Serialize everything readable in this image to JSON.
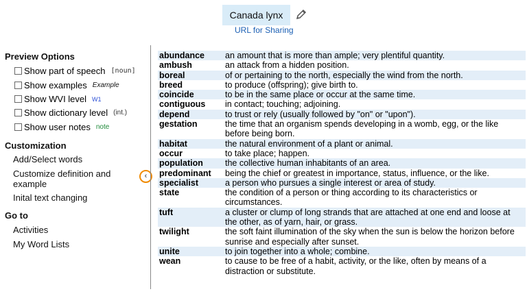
{
  "header": {
    "title": "Canada lynx",
    "share_link": "URL for Sharing"
  },
  "sidebar": {
    "preview_heading": "Preview Options",
    "options": [
      {
        "label": "Show part of speech",
        "extra": "[noun]",
        "checked": false
      },
      {
        "label": "Show examples",
        "extra": "Example",
        "checked": false
      },
      {
        "label": "Show WVI level",
        "extra": "W1",
        "checked": false
      },
      {
        "label": "Show dictionary level",
        "extra": "(int.)",
        "checked": false
      },
      {
        "label": "Show user notes",
        "extra": "note",
        "checked": false
      }
    ],
    "customization_heading": "Customization",
    "customization_links": [
      "Add/Select words",
      "Customize definition and example",
      "Inital text changing"
    ],
    "goto_heading": "Go to",
    "goto_links": [
      "Activities",
      "My Word Lists"
    ],
    "collapse_glyph": "‹"
  },
  "words": [
    {
      "word": "abundance",
      "definition": "an amount that is more than ample; very plentiful quantity."
    },
    {
      "word": "ambush",
      "definition": "an attack from a hidden position."
    },
    {
      "word": "boreal",
      "definition": "of or pertaining to the north, especially the wind from the north."
    },
    {
      "word": "breed",
      "definition": "to produce (offspring); give birth to."
    },
    {
      "word": "coincide",
      "definition": "to be in the same place or occur at the same time."
    },
    {
      "word": "contiguous",
      "definition": "in contact; touching; adjoining."
    },
    {
      "word": "depend",
      "definition": "to trust or rely (usually followed by \"on\" or \"upon\")."
    },
    {
      "word": "gestation",
      "definition": "the time that an organism spends developing in a womb, egg, or the like before being born."
    },
    {
      "word": "habitat",
      "definition": "the natural environment of a plant or animal."
    },
    {
      "word": "occur",
      "definition": "to take place; happen."
    },
    {
      "word": "population",
      "definition": "the collective human inhabitants of an area."
    },
    {
      "word": "predominant",
      "definition": "being the chief or greatest in importance, status, influence, or the like."
    },
    {
      "word": "specialist",
      "definition": "a person who pursues a single interest or area of study."
    },
    {
      "word": "state",
      "definition": "the condition of a person or thing according to its characteristics or circumstances."
    },
    {
      "word": "tuft",
      "definition": "a cluster or clump of long strands that are attached at one end and loose at the other, as of yarn, hair, or grass."
    },
    {
      "word": "twilight",
      "definition": "the soft faint illumination of the sky when the sun is below the horizon before sunrise and especially after sunset."
    },
    {
      "word": "unite",
      "definition": "to join together into a whole; combine."
    },
    {
      "word": "wean",
      "definition": "to cause to be free of a habit, activity, or the like, often by means of a distraction or substitute."
    }
  ],
  "colors": {
    "title_bg": "#d9ecf8",
    "row_shade": "#e3eef8",
    "link": "#1a5fb4",
    "collapse_ring": "#f08a00"
  }
}
